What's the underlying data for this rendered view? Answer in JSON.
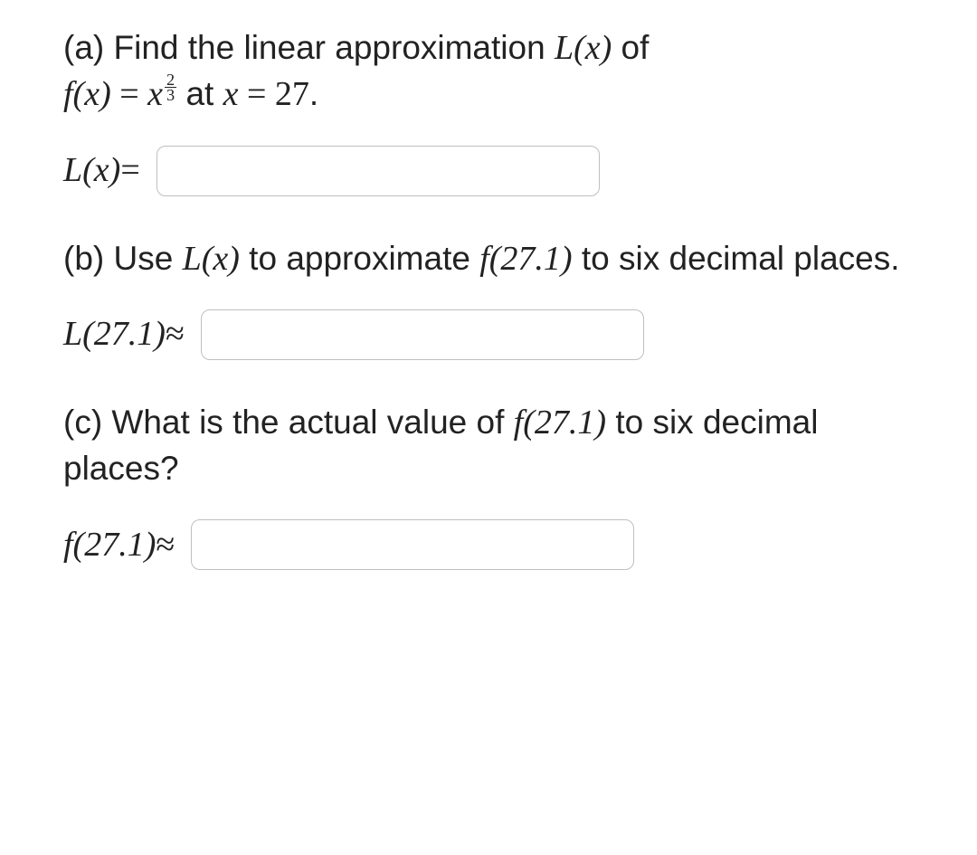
{
  "partA": {
    "label": "(a)",
    "prompt_prefix": " Find the linear approximation ",
    "Lx": "L(x)",
    "prompt_of": " of",
    "fx_lhs": "f(x)",
    "eq": " = ",
    "base": "x",
    "exp_num": "2",
    "exp_den": "3",
    "at_text": " at ",
    "x_eq": "x = 27",
    "period": ".",
    "answer_label_pre": "L(x)",
    "answer_label_rel": " = "
  },
  "partB": {
    "label": "(b)",
    "prompt_prefix": " Use ",
    "Lx": "L(x)",
    "prompt_mid": " to approximate ",
    "fval": "f(27.1)",
    "prompt_suffix": " to six decimal places.",
    "answer_label_pre": "L(27.1)",
    "answer_label_rel": " ≈ "
  },
  "partC": {
    "label": "(c)",
    "prompt_prefix": " What is the actual value of ",
    "fval": "f(27.1)",
    "prompt_suffix": " to six decimal places?",
    "answer_label_pre": "f(27.1)",
    "answer_label_rel": " ≈ "
  }
}
